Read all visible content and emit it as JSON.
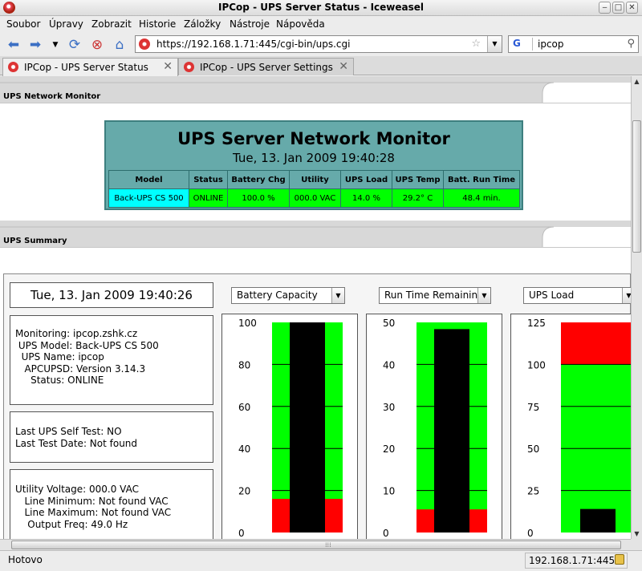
{
  "window": {
    "title": "IPCop - UPS Server Status - Iceweasel"
  },
  "menu": [
    "Soubor",
    "Úpravy",
    "Zobrazit",
    "Historie",
    "Záložky",
    "Nástroje",
    "Nápověda"
  ],
  "nav": {
    "url": "https://192.168.1.71:445/cgi-bin/ups.cgi",
    "search": "ipcop",
    "search_engine": "G"
  },
  "tabs": [
    {
      "label": "IPCop - UPS Server Status",
      "active": true
    },
    {
      "label": "IPCop - UPS Server Settings",
      "active": false
    }
  ],
  "section1": {
    "title": "UPS Network Monitor"
  },
  "monitor": {
    "title": "UPS Server Network Monitor",
    "datetime": "Tue, 13. Jan 2009 19:40:28",
    "headers": [
      "Model",
      "Status",
      "Battery Chg",
      "Utility",
      "UPS Load",
      "UPS Temp",
      "Batt. Run Time"
    ],
    "row": [
      "Back-UPS CS 500",
      "ONLINE",
      "100.0 %",
      "000.0 VAC",
      "14.0 %",
      "29.2° C",
      "48.4 min."
    ]
  },
  "section2": {
    "title": "UPS Summary"
  },
  "summary": {
    "datetime": "Tue, 13. Jan 2009 19:40:26",
    "info1": [
      "Monitoring: ipcop.zshk.cz",
      " UPS Model: Back-UPS CS 500",
      "  UPS Name: ipcop",
      "   APCUPSD: Version 3.14.3",
      "     Status: ONLINE"
    ],
    "info2": [
      "Last UPS Self Test: NO",
      "Last Test Date: Not found"
    ],
    "info3": [
      "Utility Voltage: 000.0 VAC",
      "   Line Minimum: Not found VAC",
      "   Line Maximum: Not found VAC",
      "    Output Freq: 49.0 Hz"
    ]
  },
  "charts": [
    {
      "label": "Battery Capacity",
      "ticks": [
        "100",
        "80",
        "60",
        "40",
        "20",
        "0"
      ],
      "max": 100,
      "value": 100,
      "low_fraction": 0.16,
      "high_fraction": 0
    },
    {
      "label": "Run Time Remaining",
      "ticks": [
        "50",
        "40",
        "30",
        "20",
        "10",
        "0"
      ],
      "max": 50,
      "value": 48.4,
      "low_fraction": 0.11,
      "high_fraction": 0
    },
    {
      "label": "UPS Load",
      "ticks": [
        "125",
        "100",
        "75",
        "50",
        "25",
        "0"
      ],
      "max": 125,
      "value": 14,
      "low_fraction": 0,
      "high_fraction": 0.2
    }
  ],
  "colors": {
    "ok": "#00ff00",
    "alarm": "#ff0000",
    "bar": "#000000",
    "teal": "#66aaaa",
    "cyan": "#00ffff"
  },
  "status": {
    "text": "Hotovo",
    "host": "192.168.1.71:445"
  }
}
